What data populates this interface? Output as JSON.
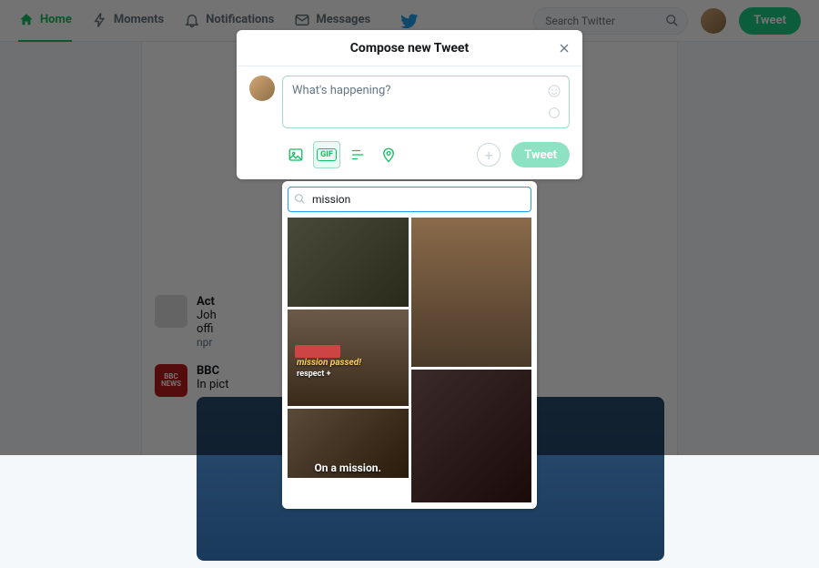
{
  "nav": {
    "home": "Home",
    "moments": "Moments",
    "notifications": "Notifications",
    "messages": "Messages"
  },
  "search": {
    "placeholder": "Search Twitter"
  },
  "topbar": {
    "tweet": "Tweet"
  },
  "bg": {
    "card1_title": "Act",
    "card1_l1": "Joh",
    "card1_l2": "offi",
    "card1_src": "npr",
    "card2_user": "BBC",
    "card2_txt": "In pict"
  },
  "modal": {
    "title": "Compose new Tweet",
    "placeholder": "What's happening?",
    "gif_badge": "GIF",
    "tweet": "Tweet"
  },
  "gif": {
    "search_value": "mission",
    "g2_line1": "mission passed!",
    "g2_line2": "respect +",
    "g3_caption": "On a mission."
  }
}
